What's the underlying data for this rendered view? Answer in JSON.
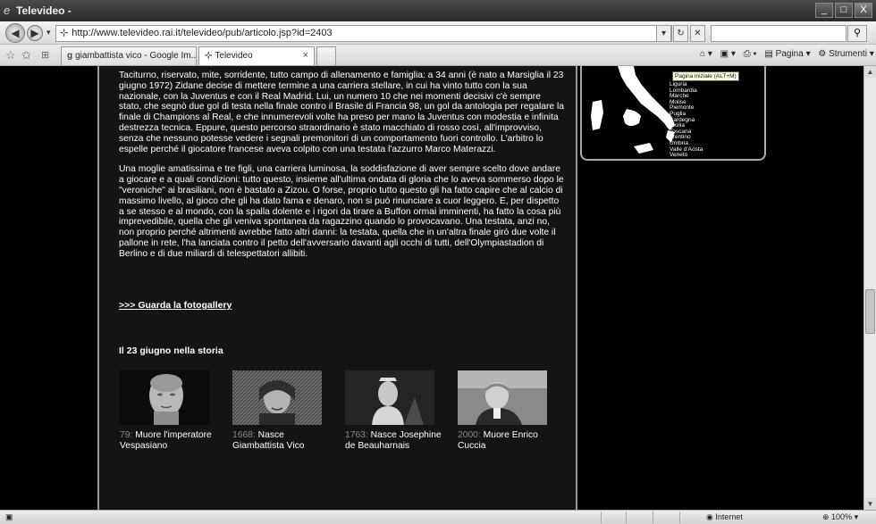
{
  "window": {
    "title": "Televideo -",
    "min": "_",
    "max": "□",
    "close": "X"
  },
  "address": {
    "url": "http://www.televideo.rai.it/televideo/pub/articolo.jsp?id=2403",
    "search_placeholder": ""
  },
  "tabs": [
    {
      "label": "giambattista vico - Google Im..."
    },
    {
      "label": "Televideo"
    }
  ],
  "toolbar": {
    "pagina": "Pagina",
    "strumenti": "Strumenti"
  },
  "article": {
    "p1": "Taciturno, riservato, mite, sorridente, tutto campo di allenamento e famiglia: a 34 anni (è nato a Marsiglia il 23 giugno 1972) Zidane decise di mettere termine a una carriera stellare, in cui ha vinto tutto con la sua nazionale, con la Juventus e con il Real Madrid. Lui, un numero 10 che nei momenti decisivi c'è sempre stato, che segnò due gol di testa nella finale contro il Brasile di Francia 98, un gol da antologia per regalare la finale di Champions al Real, e che innumerevoli volte ha preso per mano la Juventus con modestia e infinita destrezza tecnica. Eppure, questo percorso straordinario è stato macchiato di rosso così, all'improvviso, senza che nessuno potesse vedere i segnali premonitori di un comportamento fuori controllo. L'arbitro lo espelle perché il giocatore francese aveva colpito con una testata l'azzurro Marco Materazzi.",
    "p2": "Una moglie amatissima e tre figli, una carriera luminosa, la soddisfazione di aver sempre scelto dove andare a giocare e a quali condizioni: tutto questo, insieme all'ultima ondata di gloria che lo aveva sommerso dopo le \"veroniche\" ai brasiliani, non è bastato a Zizou. O forse, proprio tutto questo gli ha fatto capire che al calcio di massimo livello, al gioco che gli ha dato fama e denaro, non si può rinunciare a cuor leggero. E, per dispetto a se stesso e al mondo, con la spalla dolente e i rigori da tirare a Buffon ormai imminenti, ha fatto la cosa più imprevedibile, quella che gli veniva spontanea da ragazzino quando lo provocavano. Una testata, anzi no, non proprio perché altrimenti avrebbe fatto altri danni: la testata, quella che in un'altra finale girò due volte il pallone in rete, l'ha lanciata contro il petto dell'avversario davanti agli occhi di tutti, dell'Olympiastadion di Berlino e di due miliardi di telespettatori allibiti.",
    "gallery_link": ">>> Guarda la fotogallery"
  },
  "history": {
    "title": "Il 23 giugno nella storia",
    "items": [
      {
        "year": "79:",
        "text": "Muore l'imperatore Vespasiano"
      },
      {
        "year": "1668:",
        "text": "Nasce Giambattista Vico"
      },
      {
        "year": "1763:",
        "text": "Nasce Josephine de Beauharnais"
      },
      {
        "year": "2000:",
        "text": "Muore Enrico Cuccia"
      }
    ]
  },
  "map": {
    "tooltip": "Pagina iniziale (ALT+M)",
    "regions": [
      "Liguria",
      "Lombardia",
      "Marche",
      "Molise",
      "Piemonte",
      "Puglia",
      "Sardegna",
      "Sicilia",
      "Toscana",
      "Trentino",
      "Umbria",
      "Valle d'Aosta",
      "Veneto"
    ]
  },
  "status": {
    "zone": "Internet",
    "zoom": "100%"
  }
}
